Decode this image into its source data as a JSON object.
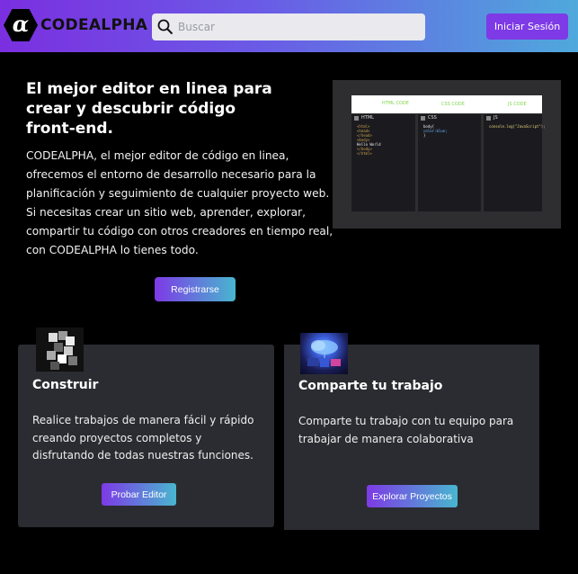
{
  "header": {
    "logo_glyph": "α",
    "brand": "CODEALPHA",
    "search_placeholder": "Buscar",
    "login_label": "Iniciar Sesión",
    "colors": {
      "gradient_start": "#7b2fe0",
      "gradient_end": "#4fa9dc",
      "login_button": "#7d3ae6"
    }
  },
  "hero": {
    "title_line1": "El mejor editor en linea para",
    "title_line2": "crear y descubrir código",
    "title_line3": "front-end.",
    "text_line1": "CODEALPHA, el mejor editor de código en linea,",
    "text_line2": "ofrecemos el entorno de desarrollo necesario para la",
    "text_line3": "planificación y seguimiento de cualquier proyecto web.",
    "text_line4": "Si necesitas crear un sitio web, aprender, explorar,",
    "text_line5": "compartir tu código con otros creadores en tiempo real,",
    "text_line6": "con CODEALPHA lo tienes todo.",
    "register_label": "Registrarse"
  },
  "editor_preview": {
    "panes": [
      {
        "label": "HTML",
        "annotation": "HTML CODE",
        "code": [
          "<html>",
          "  <head>",
          "  </head>",
          "  <body>",
          "    Hello World",
          "  </body>",
          "</html>"
        ]
      },
      {
        "label": "CSS",
        "annotation": "CSS CODE",
        "code": [
          "body{",
          "  color:blue;",
          "}"
        ]
      },
      {
        "label": "JS",
        "annotation": "JS CODE",
        "code": [
          "console.log(\"JavaScript\");"
        ]
      }
    ]
  },
  "cards": [
    {
      "title": "Construir",
      "text_line1": "Realice trabajos de manera fácil y rápido",
      "text_line2": "creando proyectos  completos y",
      "text_line3": "disfrutando de todas nuestras funciones.",
      "button_label": "Probar Editor",
      "image_icon": "cubes-image"
    },
    {
      "title": "Comparte tu trabajo",
      "text_line1": "Comparte tu trabajo con tu equipo para",
      "text_line2": "trabajar de manera colaborativa",
      "text_line3": "",
      "button_label": "Explorar Proyectos",
      "image_icon": "cloud-tech-image"
    }
  ]
}
